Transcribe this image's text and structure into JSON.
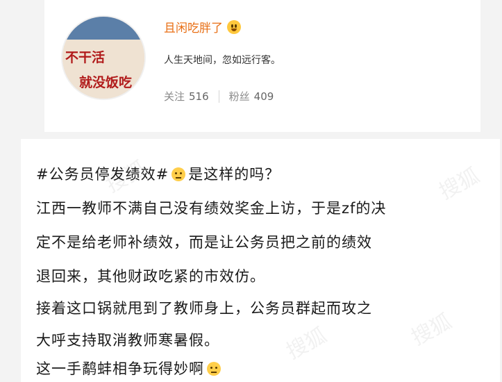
{
  "profile": {
    "name": "且闲吃胖了",
    "name_emoji": "face-emoji",
    "avatar_sign_line1": "不干活",
    "avatar_sign_line2": "就没饭吃",
    "bio": "人生天地间，忽如远行客。",
    "following_label": "关注",
    "following_count": "516",
    "followers_label": "粉丝",
    "followers_count": "409"
  },
  "post": {
    "line1_hashtag": "#公务员停发绩效#",
    "line1_rest": "是这样的吗？",
    "line2": "江西一教师不满自己没有绩效奖金上访，于是zf的决",
    "line3": "定不是给老师补绩效，而是让公务员把之前的绩效",
    "line4": "退回来，其他财政吃紧的市效仿。",
    "line5": "接着这口锅就甩到了教师身上，公务员群起而攻之",
    "line6": "大呼支持取消教师寒暑假。",
    "line7": "这一手鹬蚌相争玩得妙啊"
  },
  "colors": {
    "username": "#e86d12",
    "page_bg": "#f3f3f3",
    "card_bg": "#ffffff",
    "text": "#1a1a1a"
  }
}
